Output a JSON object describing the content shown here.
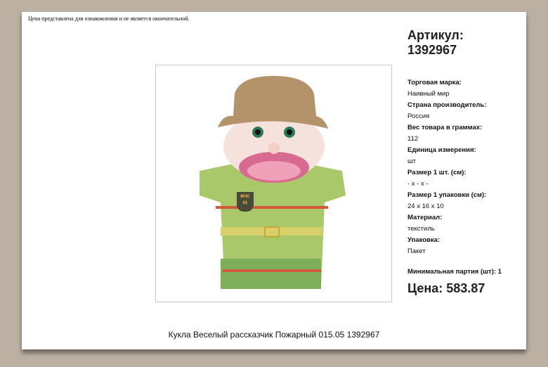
{
  "notice": "Цена представлена для ознакомления и не является окончательной.",
  "article": {
    "label": "Артикул:",
    "value": "1392967"
  },
  "properties": [
    {
      "key": "Торговая марка:",
      "value": "Наивный мир"
    },
    {
      "key": "Страна производитель:",
      "value": "Россия"
    },
    {
      "key": "Вес товара в граммах:",
      "value": "112"
    },
    {
      "key": "Единица измерения:",
      "value": "шт"
    },
    {
      "key": "Размер 1 шт. (см):",
      "value": "- x - x -"
    },
    {
      "key": "Размер 1 упаковки (см):",
      "value": "24 x 16 x 10"
    },
    {
      "key": "Материал:",
      "value": "текстиль"
    },
    {
      "key": "Упаковка:",
      "value": "Пакет"
    }
  ],
  "min_batch": "Минимальная партия (шт): 1",
  "price": "Цена: 583.87",
  "product_title": "Кукла Веселый рассказчик Пожарный 015.05   1392967",
  "badge_text": "МЧС 01"
}
